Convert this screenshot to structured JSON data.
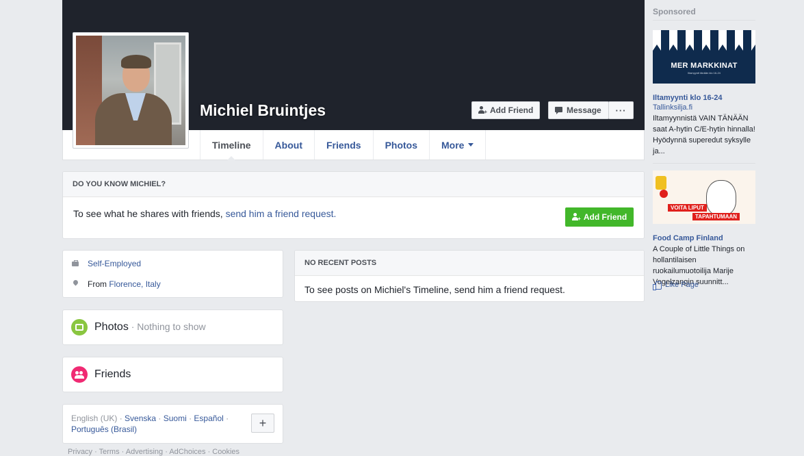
{
  "profile": {
    "name": "Michiel Bruintjes",
    "add_friend_label": "Add Friend",
    "message_label": "Message",
    "more_label": "···"
  },
  "nav": {
    "tabs": [
      {
        "label": "Timeline"
      },
      {
        "label": "About"
      },
      {
        "label": "Friends"
      },
      {
        "label": "Photos"
      },
      {
        "label": "More"
      }
    ]
  },
  "know_box": {
    "heading": "DO YOU KNOW MICHIEL?",
    "text": "To see what he shares with friends, ",
    "link": "send him a friend request.",
    "button": "Add Friend"
  },
  "intro": {
    "work": "Self-Employed",
    "from_prefix": "From ",
    "from_place": "Florence, Italy"
  },
  "photos_card": {
    "title": "Photos",
    "sep": " · ",
    "status": "Nothing to show"
  },
  "friends_card": {
    "title": "Friends"
  },
  "languages": {
    "current": "English (UK)",
    "items": [
      "Svenska",
      "Suomi",
      "Español",
      "Português (Brasil)"
    ],
    "add_label": "+"
  },
  "footer": {
    "text": "Privacy · Terms · Advertising · AdChoices · Cookies"
  },
  "posts": {
    "heading": "NO RECENT POSTS",
    "text": "To see posts on Michiel's Timeline, send him a friend request."
  },
  "ads": {
    "sponsored_label": "Sponsored",
    "items": [
      {
        "image_text": "MER MARKKINAT",
        "image_subtext": "Iltamyynti tänään klo 16-24",
        "title": "Iltamyynti klo 16-24",
        "domain": "Tallinksilja.fi",
        "body": "Iltamyynnistä VAIN TÄNÄÄN saat A-hytin C/E-hytin hinnalla! Hyödynnä superedut syksylle ja..."
      },
      {
        "image_tag1": "VOITA LIPUT",
        "image_tag2": "TAPAHTUMAAN",
        "title": "Food Camp Finland",
        "body": "A Couple of Little Things on hollantilaisen ruokailumuotoilija Marije Vogelzangin suunnitt...",
        "like_label": "Like Page"
      }
    ]
  },
  "colors": {
    "cover": "#1f232c",
    "link": "#365899",
    "green_button": "#42b72a",
    "page_bg": "#e9ebee"
  }
}
